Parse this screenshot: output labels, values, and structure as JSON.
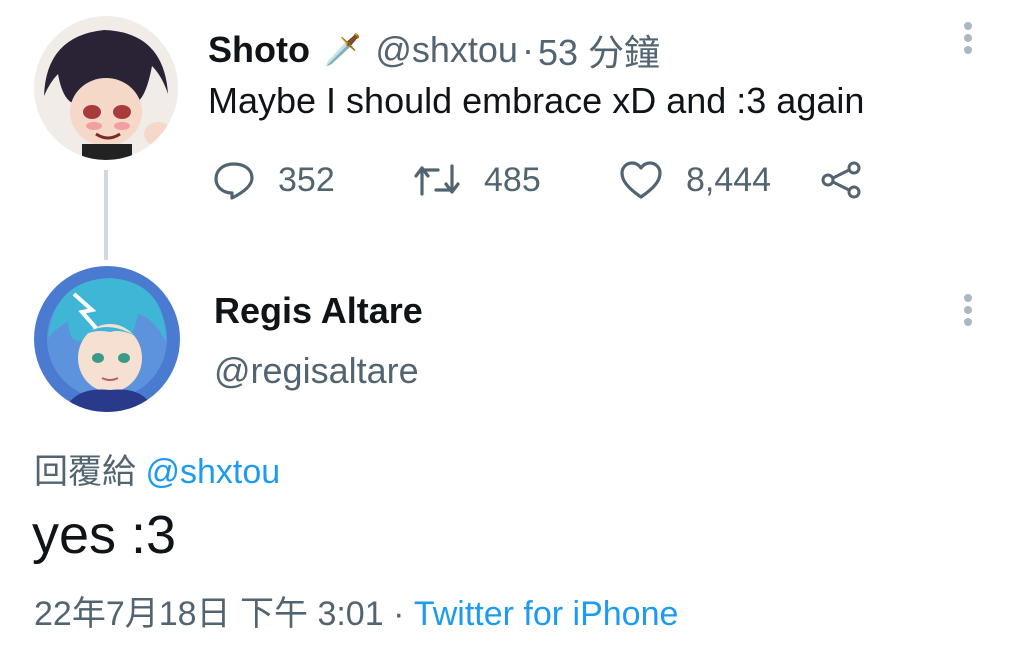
{
  "tweet1": {
    "name": "Shoto",
    "emoji": "🗡️",
    "handle": "@shxtou",
    "dot": " · ",
    "time": "53 分鐘",
    "text": "Maybe I should embrace xD and :3 again",
    "replies": "352",
    "retweets": "485",
    "likes": "8,444"
  },
  "tweet2": {
    "name": "Regis Altare",
    "handle": "@regisaltare",
    "reply_prefix": "回覆給",
    "reply_to": "@shxtou",
    "text": "yes :3",
    "date": "22年7月18日 下午 3:01",
    "dot": " · ",
    "source": "Twitter for iPhone"
  },
  "colors": {
    "accent": "#1d9bf0",
    "muted": "#536471",
    "line": "#cfd9de"
  }
}
